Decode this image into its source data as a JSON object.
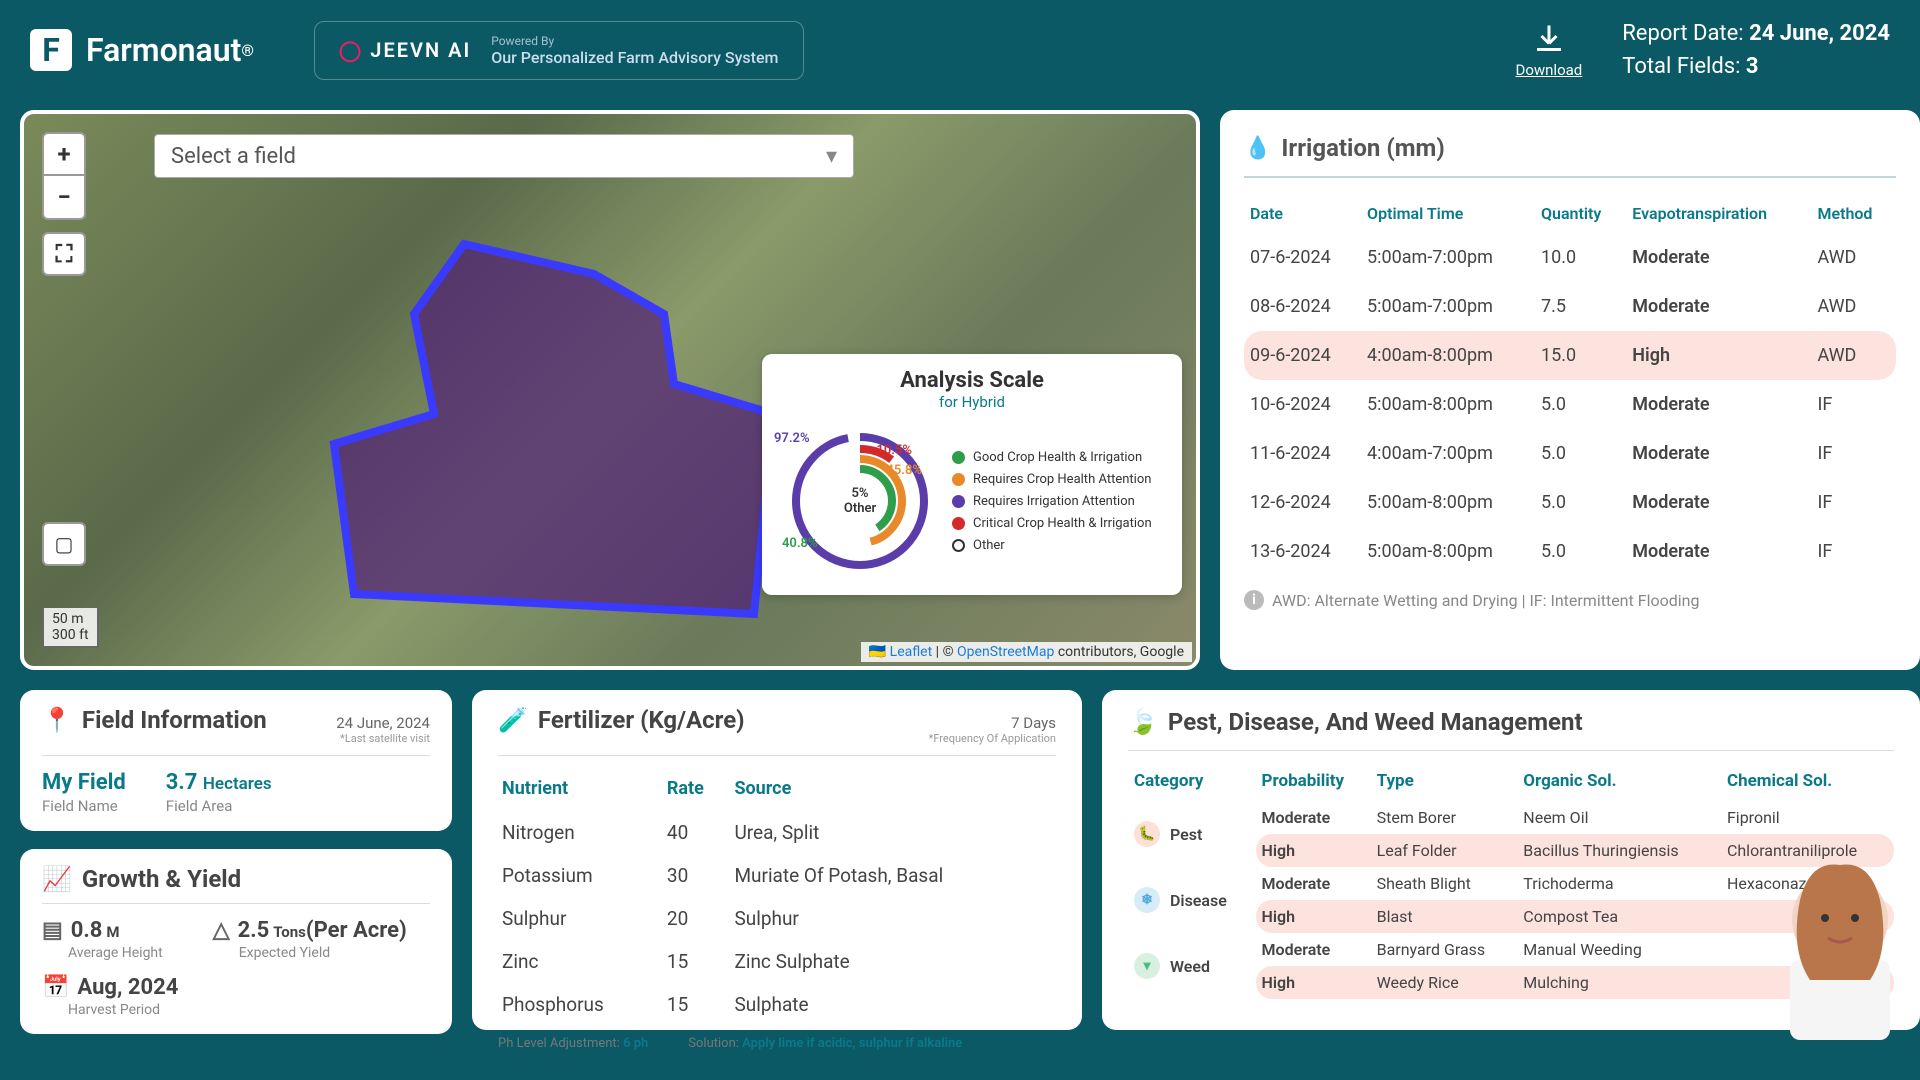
{
  "header": {
    "brand": "Farmonaut",
    "reg": "®",
    "jeevn_logo": "JEEVN AI",
    "powered_by": "Powered By",
    "jeevn_tagline": "Our Personalized Farm Advisory System",
    "download": "Download",
    "report_date_label": "Report Date:",
    "report_date": "24 June, 2024",
    "total_fields_label": "Total Fields:",
    "total_fields": "3"
  },
  "map": {
    "select_placeholder": "Select a field",
    "zoom_in": "+",
    "zoom_out": "−",
    "fullscreen": "⛶",
    "measure": "▢",
    "scale_m": "50 m",
    "scale_ft": "300 ft",
    "leaflet": "Leaflet",
    "osm": "OpenStreetMap",
    "attrib_rest": " contributors, Google",
    "analysis": {
      "title": "Analysis Scale",
      "subtitle": "for Hybrid",
      "center_val": "5%",
      "center_lbl": "Other",
      "p1": "97.2%",
      "p2": "10.5%",
      "p3": "45.8%",
      "p4": "40.8%",
      "legend": [
        {
          "color": "#2e9e4a",
          "label": "Good Crop Health & Irrigation"
        },
        {
          "color": "#e88a2a",
          "label": "Requires Crop Health Attention"
        },
        {
          "color": "#5a3da8",
          "label": "Requires Irrigation Attention"
        },
        {
          "color": "#d22a2a",
          "label": "Critical Crop Health & Irrigation"
        },
        {
          "color": "#ffffff",
          "label": "Other",
          "border": true
        }
      ]
    }
  },
  "irrigation": {
    "title": "Irrigation (mm)",
    "cols": [
      "Date",
      "Optimal Time",
      "Quantity",
      "Evapotranspiration",
      "Method"
    ],
    "rows": [
      {
        "date": "07-6-2024",
        "time": "5:00am-7:00pm",
        "qty": "10.0",
        "evap": "Moderate",
        "method": "AWD",
        "high": false
      },
      {
        "date": "08-6-2024",
        "time": "5:00am-7:00pm",
        "qty": "7.5",
        "evap": "Moderate",
        "method": "AWD",
        "high": false
      },
      {
        "date": "09-6-2024",
        "time": "4:00am-8:00pm",
        "qty": "15.0",
        "evap": "High",
        "method": "AWD",
        "high": true
      },
      {
        "date": "10-6-2024",
        "time": "5:00am-8:00pm",
        "qty": "5.0",
        "evap": "Moderate",
        "method": "IF",
        "high": false
      },
      {
        "date": "11-6-2024",
        "time": "4:00am-7:00pm",
        "qty": "5.0",
        "evap": "Moderate",
        "method": "IF",
        "high": false
      },
      {
        "date": "12-6-2024",
        "time": "5:00am-8:00pm",
        "qty": "5.0",
        "evap": "Moderate",
        "method": "IF",
        "high": false
      },
      {
        "date": "13-6-2024",
        "time": "5:00am-8:00pm",
        "qty": "5.0",
        "evap": "Moderate",
        "method": "IF",
        "high": false
      }
    ],
    "note": "AWD: Alternate Wetting and Drying | IF: Intermittent Flooding"
  },
  "field_info": {
    "title": "Field Information",
    "date": "24 June, 2024",
    "date_note": "*Last satellite visit",
    "name_val": "My Field",
    "name_lbl": "Field Name",
    "area_val": "3.7",
    "area_unit": "Hectares",
    "area_lbl": "Field Area"
  },
  "growth": {
    "title": "Growth & Yield",
    "height_val": "0.8",
    "height_unit": "M",
    "height_lbl": "Average Height",
    "yield_val": "2.5",
    "yield_unit": "Tons",
    "yield_sub": "(Per Acre)",
    "yield_lbl": "Expected Yield",
    "harvest_val": "Aug, 2024",
    "harvest_lbl": "Harvest Period"
  },
  "fertilizer": {
    "title": "Fertilizer (Kg/Acre)",
    "freq": "7 Days",
    "freq_note": "*Frequency Of Application",
    "cols": [
      "Nutrient",
      "Rate",
      "Source"
    ],
    "rows": [
      {
        "n": "Nitrogen",
        "r": "40",
        "s": "Urea, Split"
      },
      {
        "n": "Potassium",
        "r": "30",
        "s": "Muriate Of Potash, Basal"
      },
      {
        "n": "Sulphur",
        "r": "20",
        "s": "Sulphur"
      },
      {
        "n": "Zinc",
        "r": "15",
        "s": "Zinc Sulphate"
      },
      {
        "n": "Phosphorus",
        "r": "15",
        "s": "Sulphate"
      }
    ],
    "ph_lbl": "Ph Level Adjustment:",
    "ph_val": "6 ph",
    "sol_lbl": "Solution:",
    "sol_val": "Apply lime if acidic, sulphur if alkaline"
  },
  "pest": {
    "title": "Pest, Disease, And Weed Management",
    "cols": [
      "Category",
      "Probability",
      "Type",
      "Organic Sol.",
      "Chemical Sol."
    ],
    "groups": [
      {
        "cat": "Pest",
        "icon": "pest",
        "rows": [
          {
            "prob": "Moderate",
            "type": "Stem Borer",
            "org": "Neem Oil",
            "chem": "Fipronil",
            "high": false
          },
          {
            "prob": "High",
            "type": "Leaf Folder",
            "org": "Bacillus Thuringiensis",
            "chem": "Chlorantraniliprole",
            "high": true
          }
        ]
      },
      {
        "cat": "Disease",
        "icon": "disease",
        "rows": [
          {
            "prob": "Moderate",
            "type": "Sheath Blight",
            "org": "Trichoderma",
            "chem": "Hexaconazole",
            "high": false
          },
          {
            "prob": "High",
            "type": "Blast",
            "org": "Compost Tea",
            "chem": "",
            "high": true
          }
        ]
      },
      {
        "cat": "Weed",
        "icon": "weed",
        "rows": [
          {
            "prob": "Moderate",
            "type": "Barnyard Grass",
            "org": "Manual Weeding",
            "chem": "",
            "high": false
          },
          {
            "prob": "High",
            "type": "Weedy Rice",
            "org": "Mulching",
            "chem": "",
            "high": true
          }
        ]
      }
    ]
  }
}
